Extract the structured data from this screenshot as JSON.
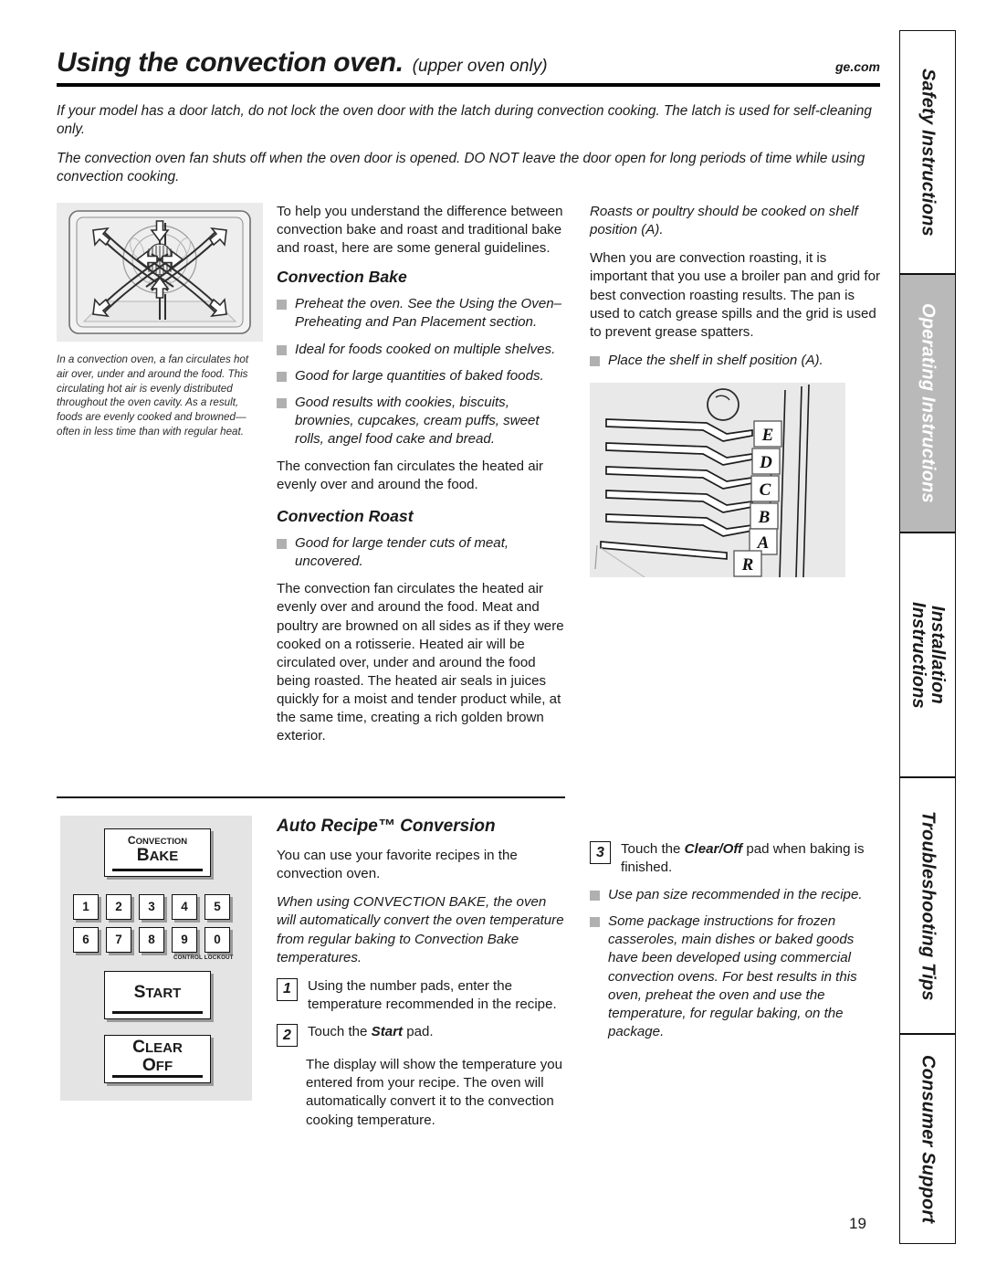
{
  "header": {
    "title": "Using the convection oven.",
    "subtitle": "(upper oven only)",
    "site": "ge.com"
  },
  "intro": {
    "p1": "If your model has a door latch, do not lock the oven door with the latch during convection cooking. The latch is used for self-cleaning only.",
    "p2": "The convection oven fan shuts off when the oven door is opened. DO NOT leave the door open for long periods of time while using convection cooking."
  },
  "left_column": {
    "figure_name": "convection-oven-airflow-diagram",
    "caption": "In a convection oven, a fan circulates hot air over, under and around the food. This circulating hot air is evenly distributed throughout the oven cavity. As a result, foods are evenly cooked and browned—often in less time than with regular heat."
  },
  "middle_column": {
    "intro": "To help you understand the difference between convection bake and roast and traditional bake and roast, here are some general guidelines.",
    "convection_bake": {
      "heading": "Convection Bake",
      "bullets": [
        "Preheat the oven. See the Using the Oven–Preheating and Pan Placement section.",
        "Ideal for foods cooked on multiple shelves.",
        "Good for large quantities of baked foods.",
        "Good results with cookies, biscuits, brownies, cupcakes, cream puffs, sweet rolls, angel food cake and bread."
      ],
      "closing": "The convection fan circulates the heated air evenly over and around the food."
    },
    "convection_roast": {
      "heading": "Convection Roast",
      "bullets": [
        "Good for large tender cuts of meat, uncovered."
      ],
      "closing": "The convection fan circulates the heated air evenly over and around the food. Meat and poultry are browned on all sides as if they were cooked on a rotisserie. Heated air will be circulated over, under and around the food being roasted. The heated air seals in juices quickly for a moist and tender product while, at the same time, creating a rich golden brown exterior."
    }
  },
  "right_column": {
    "p1": "Roasts or poultry should be cooked on shelf position (A).",
    "p2": "When you are convection roasting, it is important that you use a broiler pan and grid for best convection roasting results. The pan is used to catch grease spills and the grid is used to prevent grease spatters.",
    "bullet1": "Place the shelf in shelf position (A).",
    "shelf_figure": {
      "name": "oven-shelf-positions-diagram",
      "labels": [
        "E",
        "D",
        "C",
        "B",
        "A",
        "R"
      ]
    }
  },
  "control_panel": {
    "convection_bake_line1": "Convection",
    "convection_bake_line2": "Bake",
    "numbers_row1": [
      "1",
      "2",
      "3",
      "4",
      "5"
    ],
    "numbers_row2": [
      "6",
      "7",
      "8",
      "9",
      "0"
    ],
    "lockout_label": "Control Lockout",
    "start": "Start",
    "clear_line1": "Clear",
    "clear_line2": "Off"
  },
  "auto_recipe": {
    "heading": "Auto Recipe™ Conversion",
    "intro": "You can use your favorite recipes in the convection oven.",
    "note": "When using CONVECTION BAKE, the oven will automatically convert the oven temperature from regular baking to Convection Bake temperatures.",
    "steps": [
      {
        "num": "1",
        "text": "Using the number pads, enter the temperature recommended in the recipe."
      },
      {
        "num": "2",
        "text_before": "Touch the ",
        "bold": "Start",
        "text_after": " pad."
      },
      {
        "num": "3",
        "text_before": "Touch the ",
        "bold": "Clear/Off",
        "text_after": " pad when baking is finished."
      }
    ],
    "step2_followup": "The display will show the temperature you entered from your recipe. The oven will automatically convert it to the convection cooking temperature.",
    "bullets": [
      "Use pan size recommended in the recipe.",
      "Some package instructions for frozen casseroles, main dishes or baked goods have been developed using commercial convection ovens. For best results in this oven, preheat the oven and use the temperature, for regular baking, on the package."
    ]
  },
  "sidebar": {
    "tabs": [
      {
        "label": "Safety Instructions",
        "active": false
      },
      {
        "label": "Operating Instructions",
        "active": true
      },
      {
        "label": "Installation Instructions",
        "active": false
      },
      {
        "label": "Troubleshooting Tips",
        "active": false
      },
      {
        "label": "Consumer Support",
        "active": false
      }
    ]
  },
  "page_number": "19"
}
